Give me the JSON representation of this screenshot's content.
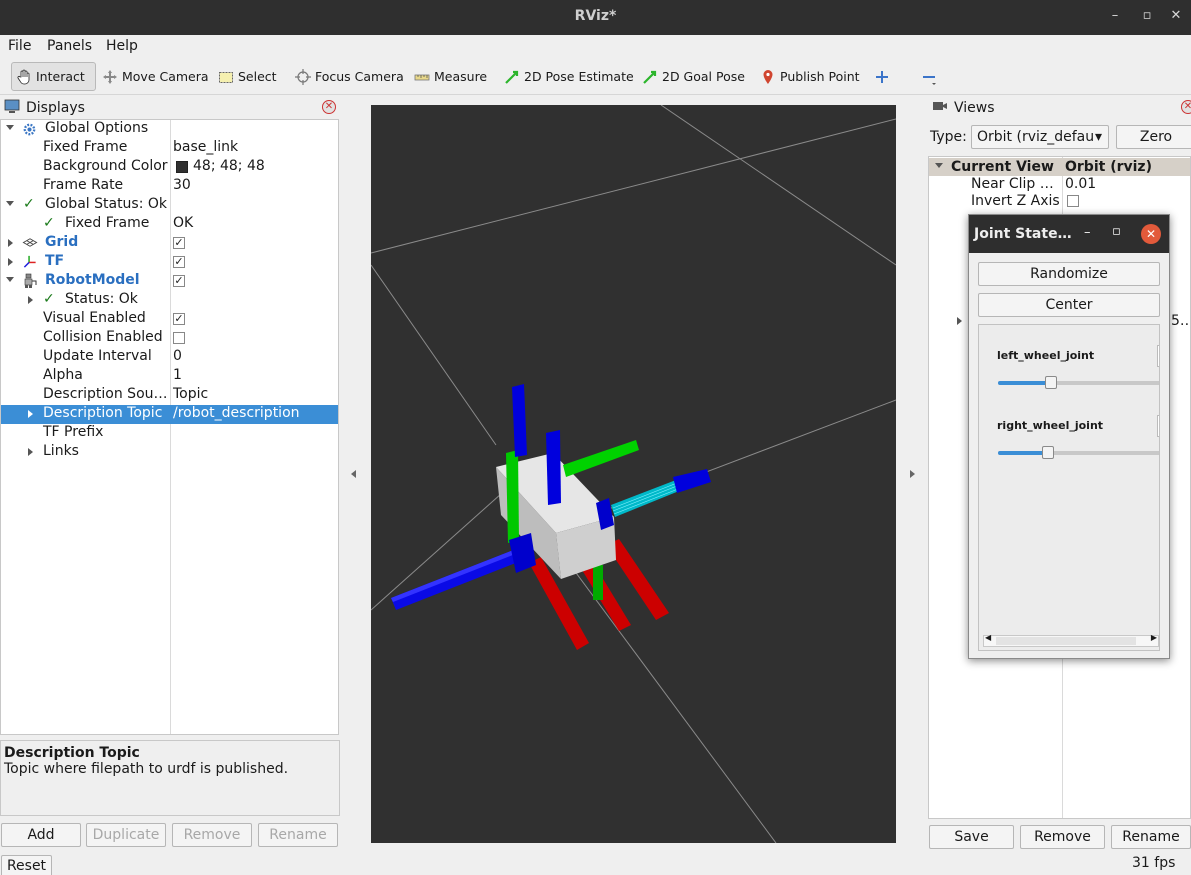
{
  "window": {
    "title": "RViz*"
  },
  "menu": {
    "file": "File",
    "panels": "Panels",
    "help": "Help"
  },
  "toolbar": {
    "interact": "Interact",
    "move_camera": "Move Camera",
    "select": "Select",
    "focus_camera": "Focus Camera",
    "measure": "Measure",
    "pose_estimate": "2D Pose Estimate",
    "goal_pose": "2D Goal Pose",
    "publish_point": "Publish Point"
  },
  "displays": {
    "title": "Displays",
    "global_options": "Global Options",
    "fixed_frame_label": "Fixed Frame",
    "fixed_frame_value": "base_link",
    "background_label": "Background Color",
    "background_value": "48; 48; 48",
    "background_color": "#303030",
    "frame_rate_label": "Frame Rate",
    "frame_rate_value": "30",
    "global_status": "Global Status: Ok",
    "status_fixed_frame_label": "Fixed Frame",
    "status_fixed_frame_value": "OK",
    "grid": "Grid",
    "tf": "TF",
    "robot_model": "RobotModel",
    "status_ok": "Status: Ok",
    "visual_enabled": "Visual Enabled",
    "collision_enabled": "Collision Enabled",
    "update_interval_label": "Update Interval",
    "update_interval_value": "0",
    "alpha_label": "Alpha",
    "alpha_value": "1",
    "description_source_label": "Description Sou…",
    "description_source_value": "Topic",
    "description_topic_label": "Description Topic",
    "description_topic_value": "/robot_description",
    "tf_prefix": "TF Prefix",
    "links": "Links"
  },
  "description": {
    "title": "Description Topic",
    "text": "Topic where filepath to urdf is published."
  },
  "display_buttons": {
    "add": "Add",
    "duplicate": "Duplicate",
    "remove": "Remove",
    "rename": "Rename"
  },
  "reset": "Reset",
  "views": {
    "title": "Views",
    "type_label": "Type:",
    "type_value": "Orbit (rviz_defau",
    "zero": "Zero",
    "current_view": "Current View",
    "current_view_value": "Orbit (rviz)",
    "near_clip_label": "Near Clip …",
    "near_clip_value": "0.01",
    "invert_z_label": "Invert Z Axis",
    "hidden_fragment": "5…",
    "save": "Save",
    "remove": "Remove",
    "rename": "Rename"
  },
  "joint_state": {
    "title": "Joint State…",
    "randomize": "Randomize",
    "center": "Center",
    "joints": [
      {
        "name": "left_wheel_joint",
        "position": 0.5
      },
      {
        "name": "right_wheel_joint",
        "position": 0.48
      }
    ]
  },
  "fps": "31 fps"
}
